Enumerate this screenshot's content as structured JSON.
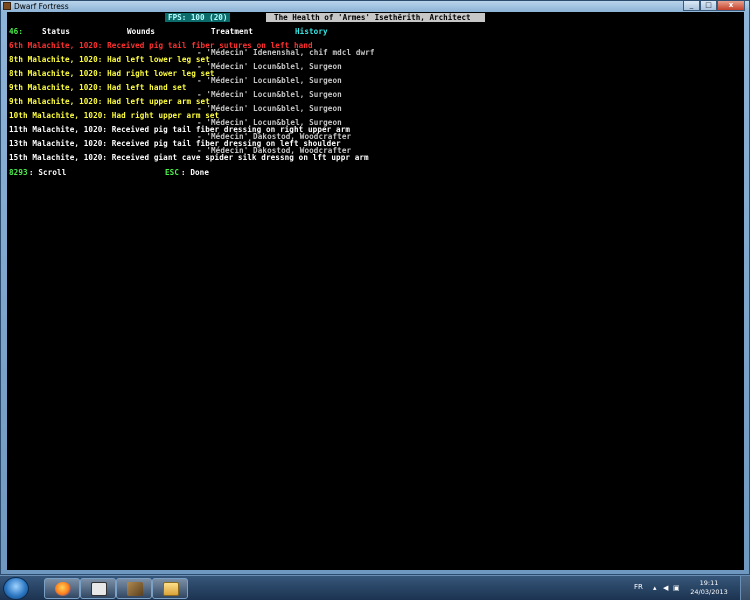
{
  "window": {
    "title": "Dwarf Fortress",
    "minimize": "_",
    "maximize": "□",
    "close": "x"
  },
  "game": {
    "fps": "FPS: 100 (20)",
    "screen_title": "The Health of 'Armes' Isethërith, Architect",
    "tabs": {
      "key": "46:",
      "status": "Status",
      "wounds": "Wounds",
      "treatment": "Treatment",
      "history": "History"
    },
    "history": [
      {
        "date": "6th Malachite, 1020:",
        "text": " Received pig tail fiber sutures on left hand",
        "color": "red"
      },
      {
        "attribution": "- 'Médecin' Idenenshal, chif mdcl dwrf"
      },
      {
        "date": "8th Malachite, 1020:",
        "text": " Had left lower leg set",
        "color": "yellow"
      },
      {
        "attribution": "- 'Médecin' Locun&blel, Surgeon"
      },
      {
        "date": "8th Malachite, 1020:",
        "text": " Had right lower leg set",
        "color": "yellow"
      },
      {
        "attribution": "- 'Médecin' Locun&blel, Surgeon"
      },
      {
        "date": "9th Malachite, 1020:",
        "text": " Had left hand set",
        "color": "yellow"
      },
      {
        "attribution": "- 'Médecin' Locun&blel, Surgeon"
      },
      {
        "date": "9th Malachite, 1020:",
        "text": " Had left upper arm set",
        "color": "yellow"
      },
      {
        "attribution": "- 'Médecin' Locun&blel, Surgeon"
      },
      {
        "date": "10th Malachite, 1020:",
        "text": " Had right upper arm set",
        "color": "yellow"
      },
      {
        "attribution": "- 'Médecin' Locun&blel, Surgeon"
      },
      {
        "date": "11th Malachite, 1020:",
        "text": " Received pig tail fiber dressing on right upper arm",
        "color": "white"
      },
      {
        "attribution": "- 'Médecin' Dakostod, Woodcrafter"
      },
      {
        "date": "13th Malachite, 1020:",
        "text": " Received pig tail fiber dressing on left shoulder",
        "color": "white"
      },
      {
        "attribution": "- 'Médecin' Dakostod, Woodcrafter"
      },
      {
        "date": "15th Malachite, 1020:",
        "text": " Received giant cave spider silk dressng on lft uppr arm",
        "color": "white"
      }
    ],
    "footer": {
      "scroll_key": "8293",
      "scroll_label": ": Scroll",
      "done_key": "ESC",
      "done_label": ": Done"
    }
  },
  "taskbar": {
    "language": "FR",
    "time": "19:11",
    "date": "24/03/2013"
  }
}
